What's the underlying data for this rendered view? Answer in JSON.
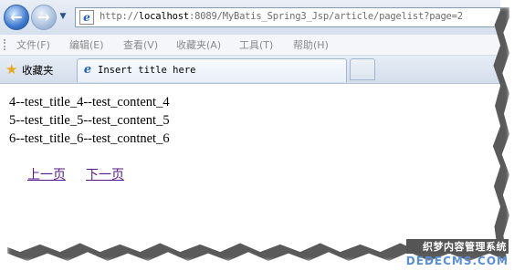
{
  "browser": {
    "url_prefix": "http://",
    "url_host": "localhost",
    "url_rest": ":8089/MyBatis_Spring3_Jsp/article/pagelist?page=2",
    "icons": {
      "back": "back-arrow-icon",
      "forward": "forward-arrow-icon",
      "history_dropdown": "chevron-down-icon",
      "page": "ie-page-icon",
      "favorites": "star-icon",
      "tab": "ie-logo-icon"
    },
    "back_glyph": "←",
    "forward_glyph": "→",
    "dropdown_glyph": "▼",
    "page_glyph": "e",
    "star_glyph": "★",
    "tab_glyph": "e"
  },
  "menu": {
    "items": [
      "文件(F)",
      "编辑(E)",
      "查看(V)",
      "收藏夹(A)",
      "工具(T)",
      "帮助(H)"
    ]
  },
  "favorites": {
    "label": "收藏夹"
  },
  "tab": {
    "title": "Insert title here"
  },
  "content": {
    "articles": [
      "4--test_title_4--test_content_4",
      "5--test_title_5--test_content_5",
      "6--test_title_6--test_contnet_6"
    ],
    "pager": {
      "prev": "上一页",
      "next": "下一页"
    }
  },
  "watermark": {
    "line1": "织梦内容管理系统",
    "line2": "DEDECMS.COM"
  },
  "colors": {
    "link_visited": "#551a8b",
    "tab_bar": "#d4deeb",
    "address_text": "#6d6d6d"
  }
}
